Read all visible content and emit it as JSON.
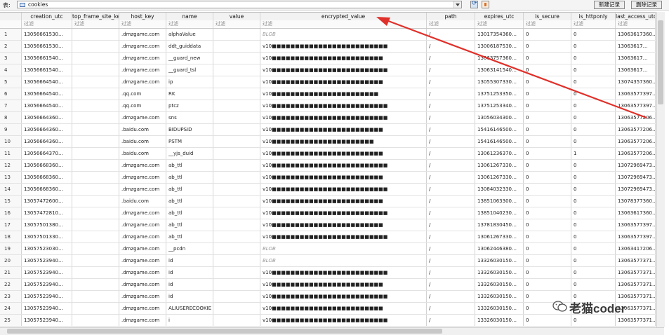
{
  "toolbar": {
    "table_label": "表:",
    "table_value": "cookies",
    "new_record": "新建记录",
    "delete_record": "删除记录",
    "icons": [
      "table-icon",
      "refresh-icon",
      "clear-filter-icon"
    ]
  },
  "columns": [
    "",
    "creation_utc",
    "top_frame_site_key",
    "host_key",
    "name",
    "value",
    "encrypted_value",
    "path",
    "expires_utc",
    "is_secure",
    "is_httponly",
    "last_access_utc"
  ],
  "filter_placeholder": "过滤",
  "rows": [
    {
      "n": "1",
      "creation": "13056661530…",
      "host": ".dmzgame.com",
      "name": "alphaValue",
      "value": "",
      "enc": "BLOB",
      "path": "/",
      "expires": "13017354360…",
      "secure": "0",
      "httponly": "0",
      "last": "13063617360…"
    },
    {
      "n": "2",
      "creation": "13056661530…",
      "host": ".dmzgame.com",
      "name": "ddt_guiddata",
      "value": "",
      "enc": "v10■■■■■■■■■■■■■■■■■■■■■■■■■",
      "path": "/",
      "expires": "13006187530…",
      "secure": "0",
      "httponly": "0",
      "last": "13063617…"
    },
    {
      "n": "3",
      "creation": "13056661540…",
      "host": ".dmzgame.com",
      "name": "__guard_new",
      "value": "",
      "enc": "v10■■■■■■■■■■■■■■■■■■■■■■■■",
      "path": "/",
      "expires": "13063757360…",
      "secure": "0",
      "httponly": "0",
      "last": "13063617…"
    },
    {
      "n": "4",
      "creation": "13056661540…",
      "host": ".dmzgame.com",
      "name": "__guard_tsl",
      "value": "",
      "enc": "v10■■■■■■■■■■■■■■■■■■■■■■■■■",
      "path": "/",
      "expires": "13063141540…",
      "secure": "0",
      "httponly": "0",
      "last": "13063617…"
    },
    {
      "n": "5",
      "creation": "13056664540…",
      "host": ".dmzgame.com",
      "name": "ip",
      "value": "",
      "enc": "v10■■■■■■■■■■■■■■■■■■■■■■■■",
      "path": "/",
      "expires": "13055307330…",
      "secure": "0",
      "httponly": "0",
      "last": "13074357360…"
    },
    {
      "n": "6",
      "creation": "13056664540…",
      "host": ".qq.com",
      "name": "RK",
      "value": "",
      "enc": "v10■■■■■■■■■■■■■■■■■■■■■■■",
      "path": "/",
      "expires": "13751253350…",
      "secure": "0",
      "httponly": "0",
      "last": "13063577397…"
    },
    {
      "n": "7",
      "creation": "13056664540…",
      "host": ".qq.com",
      "name": "ptcz",
      "value": "",
      "enc": "v10■■■■■■■■■■■■■■■■■■■■■■■■■",
      "path": "/",
      "expires": "13751253340…",
      "secure": "0",
      "httponly": "0",
      "last": "13063577397…"
    },
    {
      "n": "8",
      "creation": "13056664360…",
      "host": ".dmzgame.com",
      "name": "sns",
      "value": "",
      "enc": "v10■■■■■■■■■■■■■■■■■■■■■■■■■",
      "path": "/",
      "expires": "13056034300…",
      "secure": "0",
      "httponly": "0",
      "last": "13063577206…"
    },
    {
      "n": "9",
      "creation": "13056664360…",
      "host": ".baidu.com",
      "name": "BIDUPSID",
      "value": "",
      "enc": "v10■■■■■■■■■■■■■■■■■■■■■■■■",
      "path": "/",
      "expires": "15416146500…",
      "secure": "0",
      "httponly": "0",
      "last": "13063577206…"
    },
    {
      "n": "10",
      "creation": "13056664360…",
      "host": ".baidu.com",
      "name": "PSTM",
      "value": "",
      "enc": "v10■■■■■■■■■■■■■■■■■■■■■■",
      "path": "/",
      "expires": "15416146500…",
      "secure": "0",
      "httponly": "0",
      "last": "13063577206…"
    },
    {
      "n": "11",
      "creation": "13056664370…",
      "host": ".baidu.com",
      "name": "__yjs_duid",
      "value": "",
      "enc": "v10■■■■■■■■■■■■■■■■■■■■■■■■",
      "path": "/",
      "expires": "13061236370…",
      "secure": "0",
      "httponly": "1",
      "last": "13063577206…"
    },
    {
      "n": "12",
      "creation": "13056668360…",
      "host": ".dmzgame.com",
      "name": "ab_ttl",
      "value": "",
      "enc": "v10■■■■■■■■■■■■■■■■■■■■■■■■■",
      "path": "/",
      "expires": "13061267330…",
      "secure": "0",
      "httponly": "0",
      "last": "13072969473…"
    },
    {
      "n": "13",
      "creation": "13056668360…",
      "host": ".dmzgame.com",
      "name": "ab_ttl",
      "value": "",
      "enc": "v10■■■■■■■■■■■■■■■■■■■■■■■■",
      "path": "/",
      "expires": "13061267330…",
      "secure": "0",
      "httponly": "0",
      "last": "13072969473…"
    },
    {
      "n": "14",
      "creation": "13056668360…",
      "host": ".dmzgame.com",
      "name": "ab_ttl",
      "value": "",
      "enc": "v10■■■■■■■■■■■■■■■■■■■■■■■■■",
      "path": "/",
      "expires": "13084032330…",
      "secure": "0",
      "httponly": "0",
      "last": "13072969473…"
    },
    {
      "n": "15",
      "creation": "13057472600…",
      "host": ".baidu.com",
      "name": "ab_ttl",
      "value": "",
      "enc": "v10■■■■■■■■■■■■■■■■■■■■■■■■",
      "path": "/",
      "expires": "13851063300…",
      "secure": "0",
      "httponly": "0",
      "last": "13078377360…"
    },
    {
      "n": "16",
      "creation": "13057472810…",
      "host": ".dmzgame.com",
      "name": "ab_ttl",
      "value": "",
      "enc": "v10■■■■■■■■■■■■■■■■■■■■■■■■■",
      "path": "/",
      "expires": "13851040230…",
      "secure": "0",
      "httponly": "0",
      "last": "13063617360…"
    },
    {
      "n": "17",
      "creation": "13057501380…",
      "host": ".dmzgame.com",
      "name": "ab_ttl",
      "value": "",
      "enc": "v10■■■■■■■■■■■■■■■■■■■■■■■■",
      "path": "/",
      "expires": "13781830450…",
      "secure": "0",
      "httponly": "0",
      "last": "13063577397…"
    },
    {
      "n": "18",
      "creation": "13057501330…",
      "host": ".dmzgame.com",
      "name": "ab_ttl",
      "value": "",
      "enc": "v10■■■■■■■■■■■■■■■■■■■■■■■■■",
      "path": "/",
      "expires": "13061267330…",
      "secure": "0",
      "httponly": "0",
      "last": "13063577397…"
    },
    {
      "n": "19",
      "creation": "13057523030…",
      "host": ".dmzgame.com",
      "name": "__pcdn",
      "value": "",
      "enc": "BLOB",
      "path": "/",
      "expires": "13062446380…",
      "secure": "0",
      "httponly": "0",
      "last": "13063417206…"
    },
    {
      "n": "20",
      "creation": "13057523940…",
      "host": ".dmzgame.com",
      "name": "id",
      "value": "",
      "enc": "BLOB",
      "path": "/",
      "expires": "13326030150…",
      "secure": "0",
      "httponly": "0",
      "last": "13063577371…"
    },
    {
      "n": "21",
      "creation": "13057523940…",
      "host": ".dmzgame.com",
      "name": "id",
      "value": "",
      "enc": "v10■■■■■■■■■■■■■■■■■■■■■■■■■",
      "path": "/",
      "expires": "13326030150…",
      "secure": "0",
      "httponly": "0",
      "last": "13063577371…"
    },
    {
      "n": "22",
      "creation": "13057523940…",
      "host": ".dmzgame.com",
      "name": "id",
      "value": "",
      "enc": "v10■■■■■■■■■■■■■■■■■■■■■■■■",
      "path": "/",
      "expires": "13326030150…",
      "secure": "0",
      "httponly": "0",
      "last": "13063577371…"
    },
    {
      "n": "23",
      "creation": "13057523940…",
      "host": ".dmzgame.com",
      "name": "id",
      "value": "",
      "enc": "v10■■■■■■■■■■■■■■■■■■■■■■■■■",
      "path": "/",
      "expires": "13326030150…",
      "secure": "0",
      "httponly": "0",
      "last": "13063577371…"
    },
    {
      "n": "24",
      "creation": "13057523940…",
      "host": ".dmzgame.com",
      "name": "ALIUSERECOOKIE",
      "value": "",
      "enc": "v10■■■■■■■■■■■■■■■■■■■■■■■■",
      "path": "/",
      "expires": "13326030150…",
      "secure": "0",
      "httponly": "0",
      "last": "13063577371…"
    },
    {
      "n": "25",
      "creation": "13057523940…",
      "host": ".dmzgame.com",
      "name": "i",
      "value": "",
      "enc": "v10■■■■■■■■■■■■■■■■■■■■■■■■■",
      "path": "/",
      "expires": "13326030150…",
      "secure": "0",
      "httponly": "0",
      "last": "13063577371…"
    }
  ],
  "watermark": {
    "text": "老猫coder"
  },
  "colors": {
    "annotation_arrow": "#e0302a",
    "accent": "#4a74b0"
  }
}
